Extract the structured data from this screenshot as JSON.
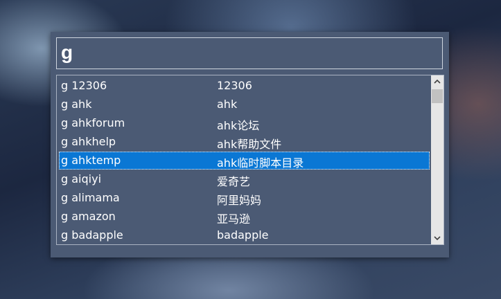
{
  "search": {
    "value": "g"
  },
  "results": [
    {
      "command": "g 12306",
      "description": "12306"
    },
    {
      "command": "g ahk",
      "description": "ahk"
    },
    {
      "command": "g ahkforum",
      "description": "ahk论坛"
    },
    {
      "command": "g ahkhelp",
      "description": "ahk帮助文件"
    },
    {
      "command": "g ahktemp",
      "description": "ahk临时脚本目录",
      "selected": true
    },
    {
      "command": "g aiqiyi",
      "description": "爱奇艺"
    },
    {
      "command": "g alimama",
      "description": "阿里妈妈"
    },
    {
      "command": "g amazon",
      "description": "亚马逊"
    },
    {
      "command": "g badapple",
      "description": "badapple"
    }
  ],
  "icons": {
    "scroll_up": "chevron-up-icon",
    "scroll_down": "chevron-down-icon"
  },
  "colors": {
    "panel": "#4b5a74",
    "selection": "#0a77d4",
    "text": "#ffffff"
  }
}
